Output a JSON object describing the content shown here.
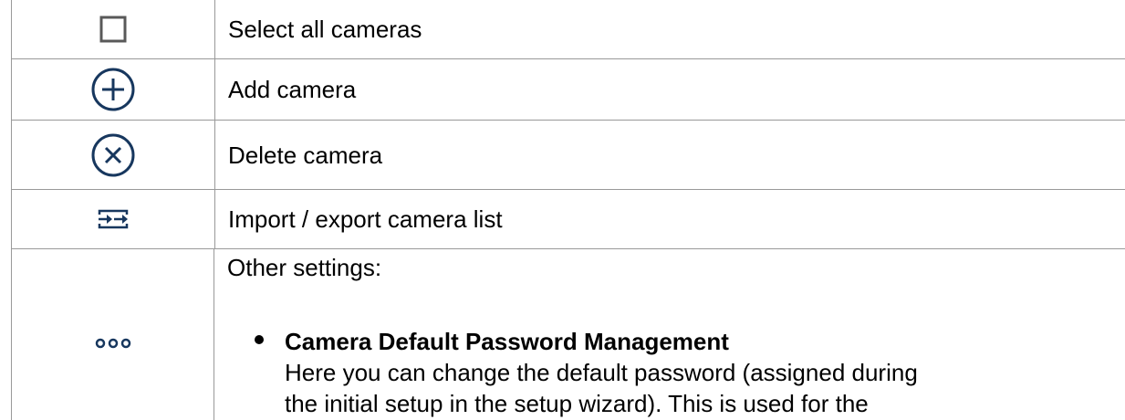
{
  "table": {
    "rows": [
      {
        "icon": "checkbox-icon",
        "label": "Select all cameras"
      },
      {
        "icon": "add-circle-icon",
        "label": "Add camera"
      },
      {
        "icon": "delete-circle-icon",
        "label": "Delete camera"
      },
      {
        "icon": "import-export-icon",
        "label": "Import / export camera list"
      },
      {
        "icon": "more-options-icon",
        "label": "Other settings:",
        "bullets": [
          {
            "title": "Camera Default Password Management",
            "description": "Here you can change the default password (assigned during the initial setup in the setup wizard). This is used for the"
          }
        ]
      }
    ]
  },
  "colors": {
    "icon": "#17375e",
    "checkbox": "#595959",
    "border": "#999999"
  }
}
